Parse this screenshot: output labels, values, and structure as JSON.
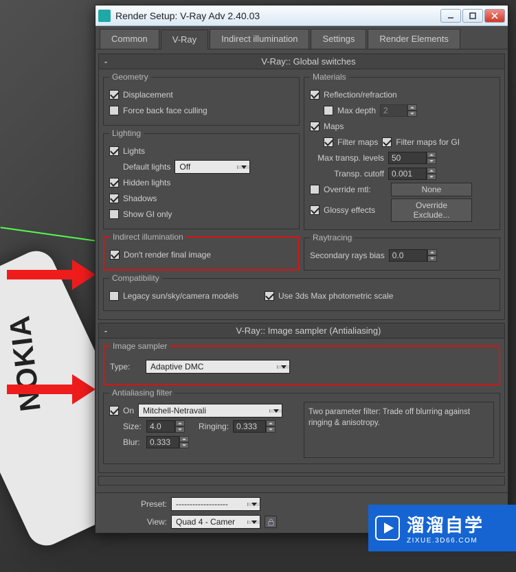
{
  "window": {
    "title": "Render Setup: V-Ray Adv 2.40.03"
  },
  "tabs": [
    "Common",
    "V-Ray",
    "Indirect illumination",
    "Settings",
    "Render Elements"
  ],
  "active_tab": 1,
  "rollout1": {
    "title": "V-Ray:: Global switches",
    "geometry": {
      "legend": "Geometry",
      "displacement": {
        "label": "Displacement",
        "checked": true
      },
      "force_bfc": {
        "label": "Force back face culling",
        "checked": false
      }
    },
    "lighting": {
      "legend": "Lighting",
      "lights": {
        "label": "Lights",
        "checked": true
      },
      "default_lights": {
        "label": "Default lights",
        "value": "Off"
      },
      "hidden": {
        "label": "Hidden lights",
        "checked": true
      },
      "shadows": {
        "label": "Shadows",
        "checked": true
      },
      "show_gi": {
        "label": "Show GI only",
        "checked": false
      }
    },
    "indirect": {
      "legend": "Indirect illumination",
      "dont_render": {
        "label": "Don't render final image",
        "checked": true
      }
    },
    "compat": {
      "legend": "Compatibility",
      "legacy": {
        "label": "Legacy sun/sky/camera models",
        "checked": false
      },
      "photometric": {
        "label": "Use 3ds Max photometric scale",
        "checked": true
      }
    },
    "materials": {
      "legend": "Materials",
      "refl": {
        "label": "Reflection/refraction",
        "checked": true
      },
      "maxdepth": {
        "label": "Max depth",
        "checked": false,
        "value": "2"
      },
      "maps": {
        "label": "Maps",
        "checked": true
      },
      "filter_maps": {
        "label": "Filter maps",
        "checked": true
      },
      "filter_maps_gi": {
        "label": "Filter maps for GI",
        "checked": true
      },
      "max_transp": {
        "label": "Max transp. levels",
        "value": "50"
      },
      "transp_cutoff": {
        "label": "Transp. cutoff",
        "value": "0.001"
      },
      "override": {
        "label": "Override mtl:",
        "checked": false,
        "btn": "None"
      },
      "glossy": {
        "label": "Glossy effects",
        "checked": true,
        "btn": "Override Exclude..."
      }
    },
    "raytracing": {
      "legend": "Raytracing",
      "secondary": {
        "label": "Secondary rays bias",
        "value": "0.0"
      }
    }
  },
  "rollout2": {
    "title": "V-Ray:: Image sampler (Antialiasing)",
    "sampler": {
      "legend": "Image sampler",
      "type_label": "Type:",
      "type_value": "Adaptive DMC"
    },
    "aa": {
      "legend": "Antialiasing filter",
      "on": {
        "label": "On",
        "checked": true
      },
      "filter_value": "Mitchell-Netravali",
      "size": {
        "label": "Size:",
        "value": "4.0"
      },
      "ringing": {
        "label": "Ringing:",
        "value": "0.333"
      },
      "blur": {
        "label": "Blur:",
        "value": "0.333"
      },
      "desc": "Two parameter filter: Trade off blurring against ringing & anisotropy."
    }
  },
  "bottom": {
    "preset_label": "Preset:",
    "preset_value": "-------------------",
    "view_label": "View:",
    "view_value": "Quad 4 - Camer"
  },
  "watermark": {
    "top": "溜溜自学",
    "bottom": "ZIXUE.3D66.COM"
  }
}
